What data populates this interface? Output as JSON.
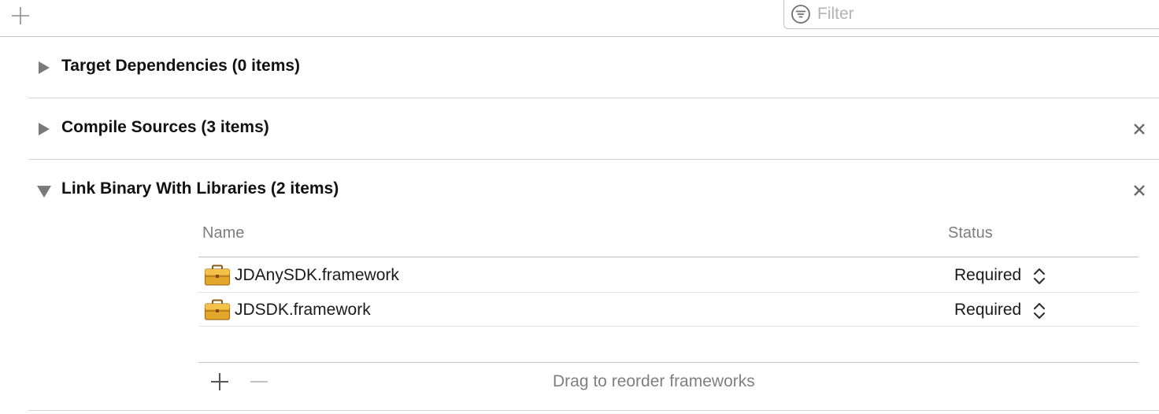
{
  "toolbar": {
    "add_icon": "plus-icon",
    "filter_placeholder": "Filter",
    "filter_value": "",
    "filter_icon": "filter-lines-icon"
  },
  "phases": [
    {
      "title": "Target Dependencies (0 items)",
      "expanded": false,
      "deletable": false
    },
    {
      "title": "Compile Sources (3 items)",
      "expanded": false,
      "deletable": true
    },
    {
      "title": "Link Binary With Libraries (2 items)",
      "expanded": true,
      "deletable": true
    }
  ],
  "libraries": {
    "columns": {
      "name": "Name",
      "status": "Status"
    },
    "rows": [
      {
        "name": "JDAnySDK.framework",
        "status": "Required",
        "icon": "toolbox-icon"
      },
      {
        "name": "JDSDK.framework",
        "status": "Required",
        "icon": "toolbox-icon"
      }
    ],
    "footer": {
      "add_icon": "plus-icon",
      "remove_icon": "minus-icon",
      "hint": "Drag to reorder frameworks"
    }
  },
  "colors": {
    "separator": "#d2d2d2",
    "icon_gray": "#7a7a7a",
    "toolbox_gold": "#e2a72b"
  }
}
